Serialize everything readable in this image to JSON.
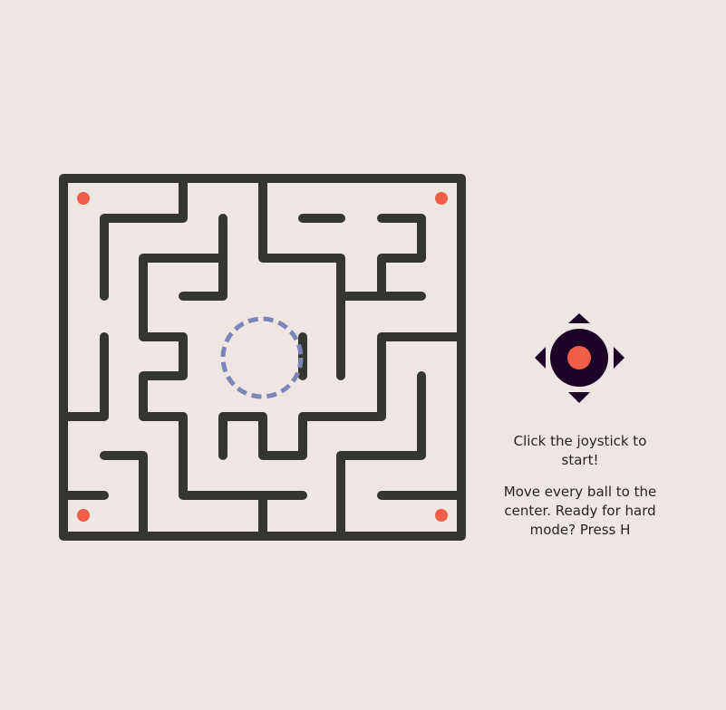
{
  "colors": {
    "background": "#EEE6E2",
    "walls": "#363630",
    "balls": "#F05E47",
    "goal_ring": "#7D84B8",
    "joystick": "#1E0228",
    "joystick_knob": "#F05E47"
  },
  "joystick": {
    "icon": "joystick-icon",
    "state": "idle"
  },
  "instructions": {
    "start": "Click the joystick to start!",
    "hint": "Move every ball to the center. Ready for hard mode? Press H"
  },
  "balls": [
    {
      "name": "ball-top-left"
    },
    {
      "name": "ball-top-right"
    },
    {
      "name": "ball-bottom-left"
    },
    {
      "name": "ball-bottom-right"
    }
  ],
  "goal": {
    "name": "center-goal"
  }
}
